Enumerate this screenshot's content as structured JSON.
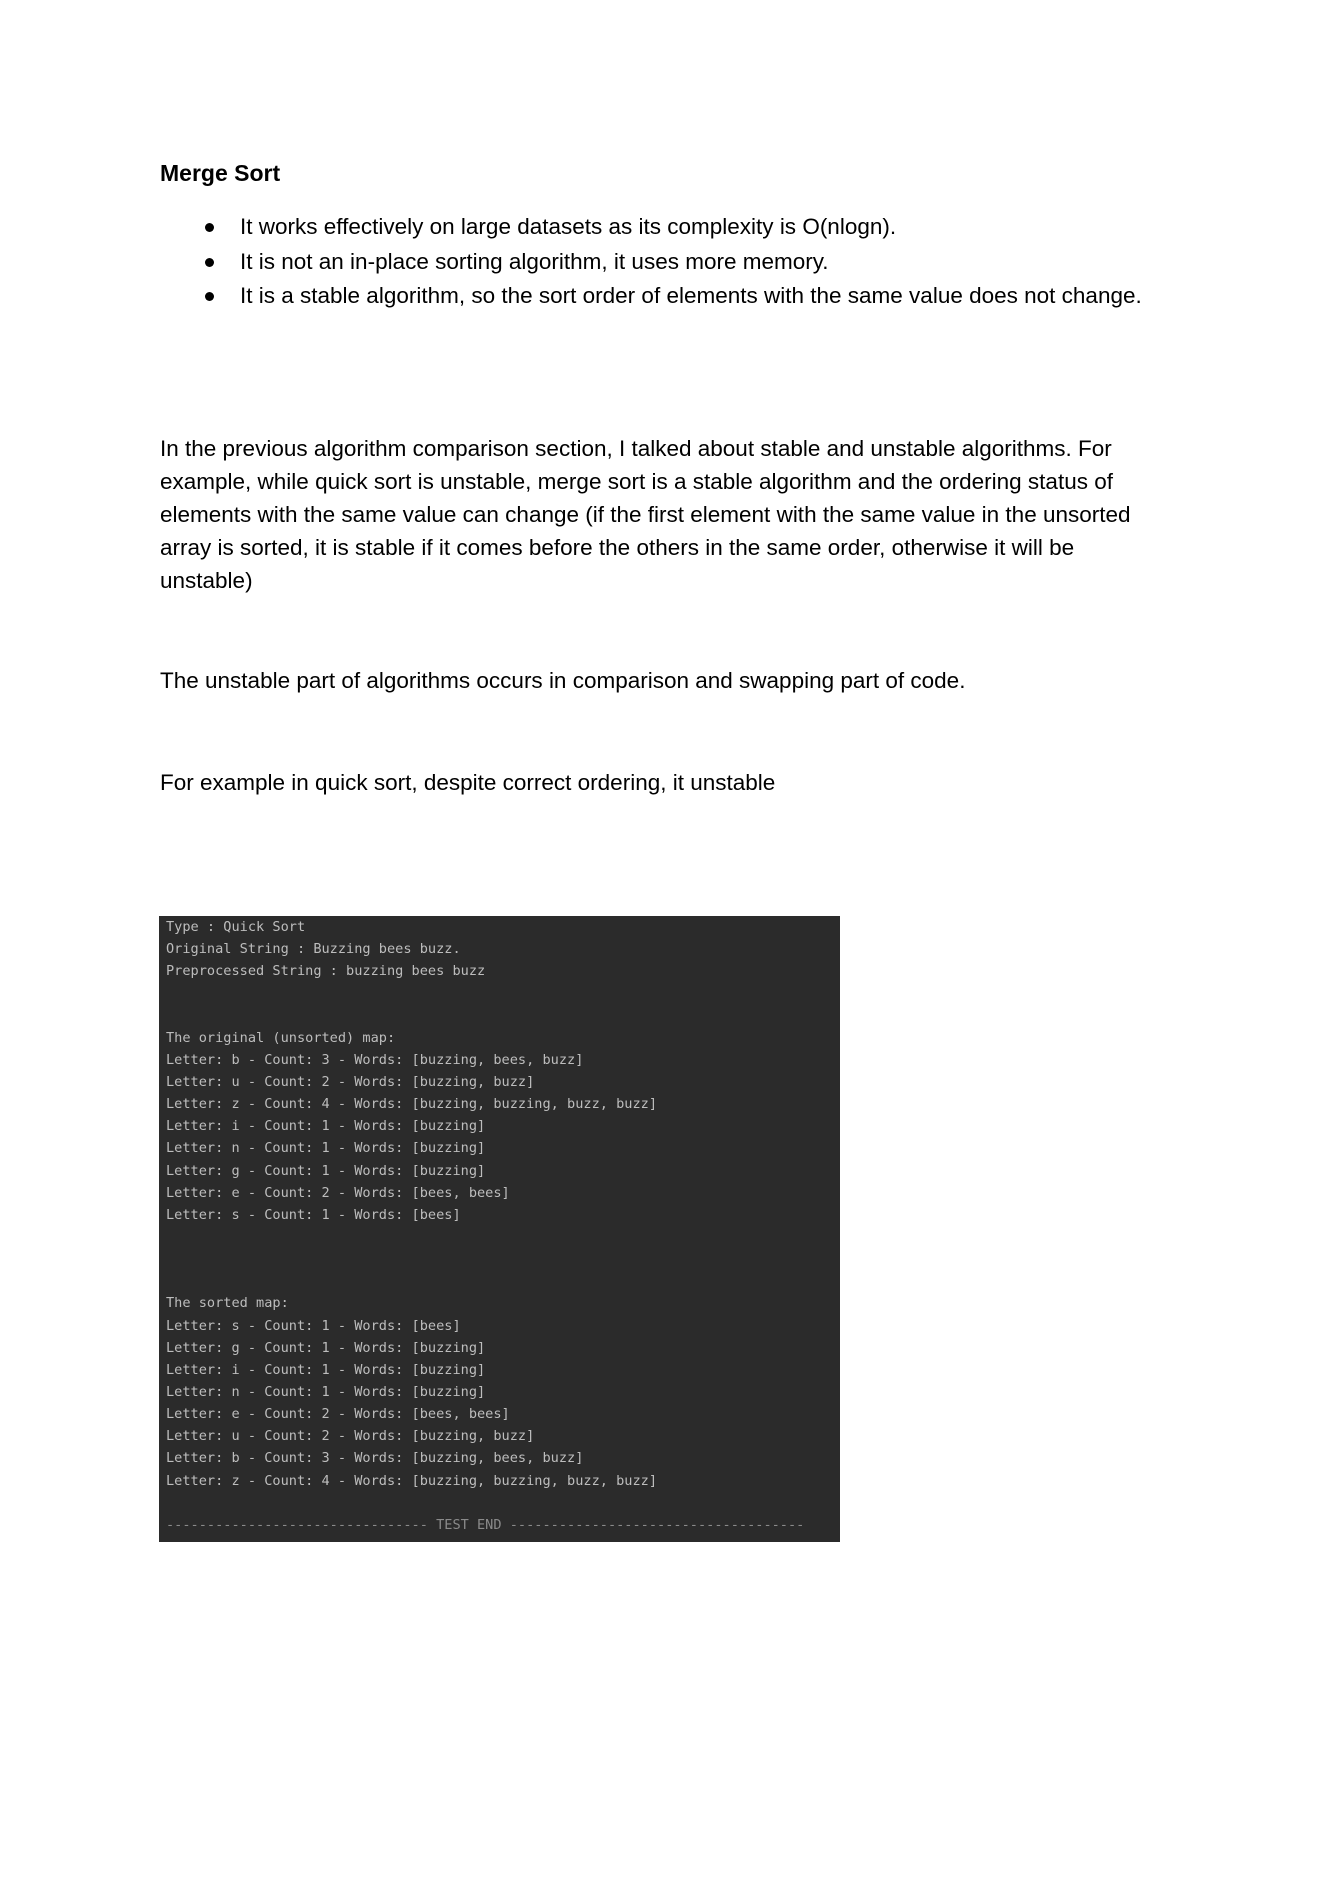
{
  "heading": "Merge Sort",
  "bullets": [
    "It works effectively on large datasets as its complexity is O(nlogn).",
    "It is not an in-place sorting algorithm, it uses more memory.",
    "It is a stable algorithm, so the sort order of elements with the same value does not change."
  ],
  "paragraphs": [
    "In the previous algorithm comparison section, I talked about stable and unstable algorithms. For example, while quick sort is unstable, merge sort is a stable algorithm and the ordering status of elements with the same value can change (if the first element with the same value in the unsorted array is sorted, it is stable if it comes before the others in the same order, otherwise it will be unstable)",
    "The unstable part of algorithms occurs in comparison and swapping part of code.",
    "For example in quick sort, despite correct ordering, it unstable"
  ],
  "console": {
    "background": "#2b2b2b",
    "lines": [
      "Type : Quick Sort",
      "Original String : Buzzing bees buzz.",
      "Preprocessed String : buzzing bees buzz",
      "",
      "",
      "The original (unsorted) map:",
      "Letter: b - Count: 3 - Words: [buzzing, bees, buzz]",
      "Letter: u - Count: 2 - Words: [buzzing, buzz]",
      "Letter: z - Count: 4 - Words: [buzzing, buzzing, buzz, buzz]",
      "Letter: i - Count: 1 - Words: [buzzing]",
      "Letter: n - Count: 1 - Words: [buzzing]",
      "Letter: g - Count: 1 - Words: [buzzing]",
      "Letter: e - Count: 2 - Words: [bees, bees]",
      "Letter: s - Count: 1 - Words: [bees]",
      "",
      "",
      "",
      "The sorted map:",
      "Letter: s - Count: 1 - Words: [bees]",
      "Letter: g - Count: 1 - Words: [buzzing]",
      "Letter: i - Count: 1 - Words: [buzzing]",
      "Letter: n - Count: 1 - Words: [buzzing]",
      "Letter: e - Count: 2 - Words: [bees, bees]",
      "Letter: u - Count: 2 - Words: [buzzing, buzz]",
      "Letter: b - Count: 3 - Words: [buzzing, bees, buzz]",
      "Letter: z - Count: 4 - Words: [buzzing, buzzing, buzz, buzz]",
      "",
      "-------------------------------- TEST END ------------------------------------"
    ]
  }
}
